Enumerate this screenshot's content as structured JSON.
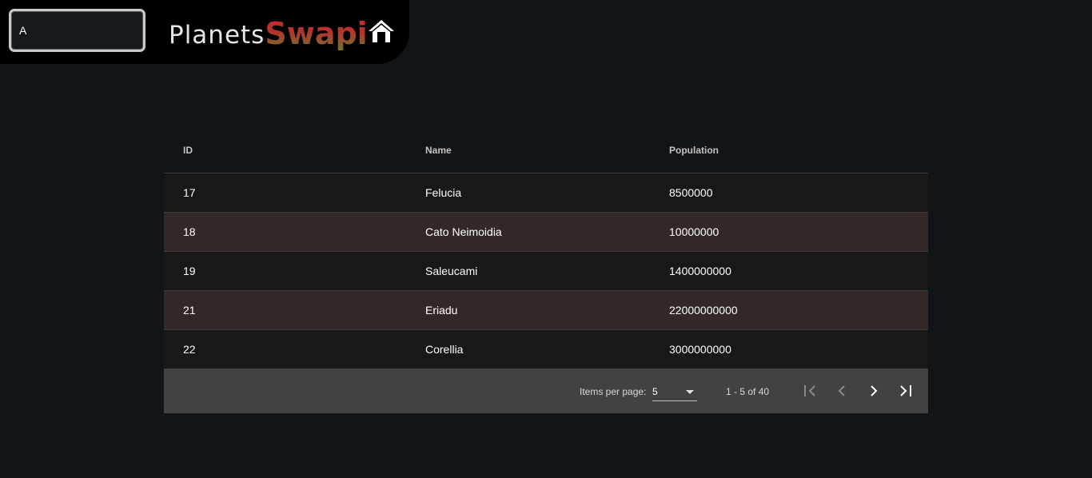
{
  "header": {
    "search_value": "A",
    "brand_primary": "Planets",
    "brand_secondary": "Swapi",
    "home_icon": "home-icon"
  },
  "table": {
    "columns": [
      "ID",
      "Name",
      "Population"
    ],
    "rows": [
      {
        "id": "17",
        "name": "Felucia",
        "population": "8500000"
      },
      {
        "id": "18",
        "name": "Cato Neimoidia",
        "population": "10000000"
      },
      {
        "id": "19",
        "name": "Saleucami",
        "population": "1400000000"
      },
      {
        "id": "21",
        "name": "Eriadu",
        "population": "22000000000"
      },
      {
        "id": "22",
        "name": "Corellia",
        "population": "3000000000"
      }
    ]
  },
  "paginator": {
    "items_per_page_label": "Items per page:",
    "items_per_page_value": "5",
    "range_label": "1 - 5 of 40",
    "buttons": {
      "first": "first-page-icon",
      "prev": "previous-page-icon",
      "next": "next-page-icon",
      "last": "last-page-icon"
    }
  },
  "colors": {
    "background": "#121518",
    "row_odd": "#181818",
    "row_even": "#332828",
    "paginator_bg": "#424242",
    "brand_red": "#d0252c"
  }
}
